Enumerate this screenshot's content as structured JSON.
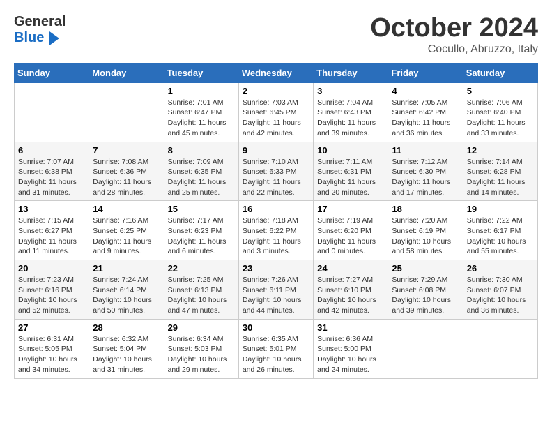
{
  "header": {
    "logo_top": "General",
    "logo_bottom": "Blue",
    "month": "October 2024",
    "location": "Cocullo, Abruzzo, Italy"
  },
  "weekdays": [
    "Sunday",
    "Monday",
    "Tuesday",
    "Wednesday",
    "Thursday",
    "Friday",
    "Saturday"
  ],
  "weeks": [
    [
      {
        "day": "",
        "info": ""
      },
      {
        "day": "",
        "info": ""
      },
      {
        "day": "1",
        "info": "Sunrise: 7:01 AM\nSunset: 6:47 PM\nDaylight: 11 hours and 45 minutes."
      },
      {
        "day": "2",
        "info": "Sunrise: 7:03 AM\nSunset: 6:45 PM\nDaylight: 11 hours and 42 minutes."
      },
      {
        "day": "3",
        "info": "Sunrise: 7:04 AM\nSunset: 6:43 PM\nDaylight: 11 hours and 39 minutes."
      },
      {
        "day": "4",
        "info": "Sunrise: 7:05 AM\nSunset: 6:42 PM\nDaylight: 11 hours and 36 minutes."
      },
      {
        "day": "5",
        "info": "Sunrise: 7:06 AM\nSunset: 6:40 PM\nDaylight: 11 hours and 33 minutes."
      }
    ],
    [
      {
        "day": "6",
        "info": "Sunrise: 7:07 AM\nSunset: 6:38 PM\nDaylight: 11 hours and 31 minutes."
      },
      {
        "day": "7",
        "info": "Sunrise: 7:08 AM\nSunset: 6:36 PM\nDaylight: 11 hours and 28 minutes."
      },
      {
        "day": "8",
        "info": "Sunrise: 7:09 AM\nSunset: 6:35 PM\nDaylight: 11 hours and 25 minutes."
      },
      {
        "day": "9",
        "info": "Sunrise: 7:10 AM\nSunset: 6:33 PM\nDaylight: 11 hours and 22 minutes."
      },
      {
        "day": "10",
        "info": "Sunrise: 7:11 AM\nSunset: 6:31 PM\nDaylight: 11 hours and 20 minutes."
      },
      {
        "day": "11",
        "info": "Sunrise: 7:12 AM\nSunset: 6:30 PM\nDaylight: 11 hours and 17 minutes."
      },
      {
        "day": "12",
        "info": "Sunrise: 7:14 AM\nSunset: 6:28 PM\nDaylight: 11 hours and 14 minutes."
      }
    ],
    [
      {
        "day": "13",
        "info": "Sunrise: 7:15 AM\nSunset: 6:27 PM\nDaylight: 11 hours and 11 minutes."
      },
      {
        "day": "14",
        "info": "Sunrise: 7:16 AM\nSunset: 6:25 PM\nDaylight: 11 hours and 9 minutes."
      },
      {
        "day": "15",
        "info": "Sunrise: 7:17 AM\nSunset: 6:23 PM\nDaylight: 11 hours and 6 minutes."
      },
      {
        "day": "16",
        "info": "Sunrise: 7:18 AM\nSunset: 6:22 PM\nDaylight: 11 hours and 3 minutes."
      },
      {
        "day": "17",
        "info": "Sunrise: 7:19 AM\nSunset: 6:20 PM\nDaylight: 11 hours and 0 minutes."
      },
      {
        "day": "18",
        "info": "Sunrise: 7:20 AM\nSunset: 6:19 PM\nDaylight: 10 hours and 58 minutes."
      },
      {
        "day": "19",
        "info": "Sunrise: 7:22 AM\nSunset: 6:17 PM\nDaylight: 10 hours and 55 minutes."
      }
    ],
    [
      {
        "day": "20",
        "info": "Sunrise: 7:23 AM\nSunset: 6:16 PM\nDaylight: 10 hours and 52 minutes."
      },
      {
        "day": "21",
        "info": "Sunrise: 7:24 AM\nSunset: 6:14 PM\nDaylight: 10 hours and 50 minutes."
      },
      {
        "day": "22",
        "info": "Sunrise: 7:25 AM\nSunset: 6:13 PM\nDaylight: 10 hours and 47 minutes."
      },
      {
        "day": "23",
        "info": "Sunrise: 7:26 AM\nSunset: 6:11 PM\nDaylight: 10 hours and 44 minutes."
      },
      {
        "day": "24",
        "info": "Sunrise: 7:27 AM\nSunset: 6:10 PM\nDaylight: 10 hours and 42 minutes."
      },
      {
        "day": "25",
        "info": "Sunrise: 7:29 AM\nSunset: 6:08 PM\nDaylight: 10 hours and 39 minutes."
      },
      {
        "day": "26",
        "info": "Sunrise: 7:30 AM\nSunset: 6:07 PM\nDaylight: 10 hours and 36 minutes."
      }
    ],
    [
      {
        "day": "27",
        "info": "Sunrise: 6:31 AM\nSunset: 5:05 PM\nDaylight: 10 hours and 34 minutes."
      },
      {
        "day": "28",
        "info": "Sunrise: 6:32 AM\nSunset: 5:04 PM\nDaylight: 10 hours and 31 minutes."
      },
      {
        "day": "29",
        "info": "Sunrise: 6:34 AM\nSunset: 5:03 PM\nDaylight: 10 hours and 29 minutes."
      },
      {
        "day": "30",
        "info": "Sunrise: 6:35 AM\nSunset: 5:01 PM\nDaylight: 10 hours and 26 minutes."
      },
      {
        "day": "31",
        "info": "Sunrise: 6:36 AM\nSunset: 5:00 PM\nDaylight: 10 hours and 24 minutes."
      },
      {
        "day": "",
        "info": ""
      },
      {
        "day": "",
        "info": ""
      }
    ]
  ]
}
